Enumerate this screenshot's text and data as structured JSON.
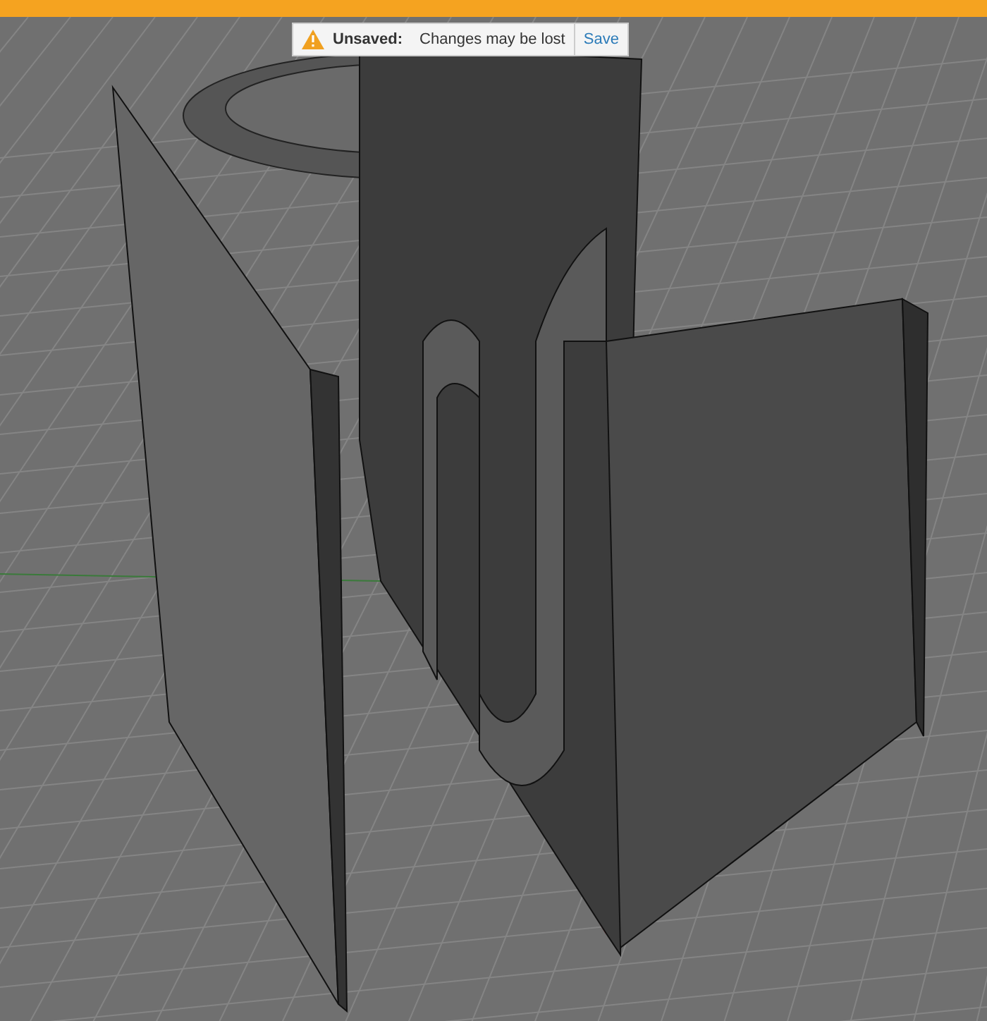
{
  "notification": {
    "label": "Unsaved:",
    "message": "Changes may be lost",
    "action": "Save"
  }
}
